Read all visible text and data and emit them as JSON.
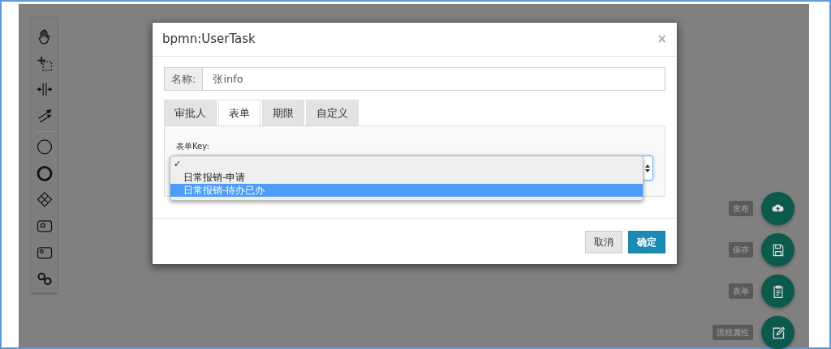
{
  "modal": {
    "title": "bpmn:UserTask",
    "close": "×",
    "name_label": "名称:",
    "name_value": "张info",
    "tabs": [
      {
        "label": "审批人",
        "selected": false
      },
      {
        "label": "表单",
        "selected": true
      },
      {
        "label": "期限",
        "selected": false
      },
      {
        "label": "自定义",
        "selected": false
      }
    ],
    "form_key_label": "表单Key:",
    "dropdown": {
      "check_mark": "✓",
      "options": [
        {
          "checked": true,
          "selected": false
        },
        {
          "label": "日常报销-申请",
          "checked": false,
          "selected": false
        },
        {
          "label": "日常报销-待办已办",
          "checked": false,
          "selected": true
        }
      ]
    },
    "buttons": [
      {
        "label": "取消",
        "kind": "secondary"
      },
      {
        "label": "确定",
        "kind": "primary"
      }
    ]
  },
  "actions": [
    {
      "label": "发布"
    },
    {
      "label": "保存"
    },
    {
      "label": "表单"
    },
    {
      "label": "流程属性"
    }
  ]
}
